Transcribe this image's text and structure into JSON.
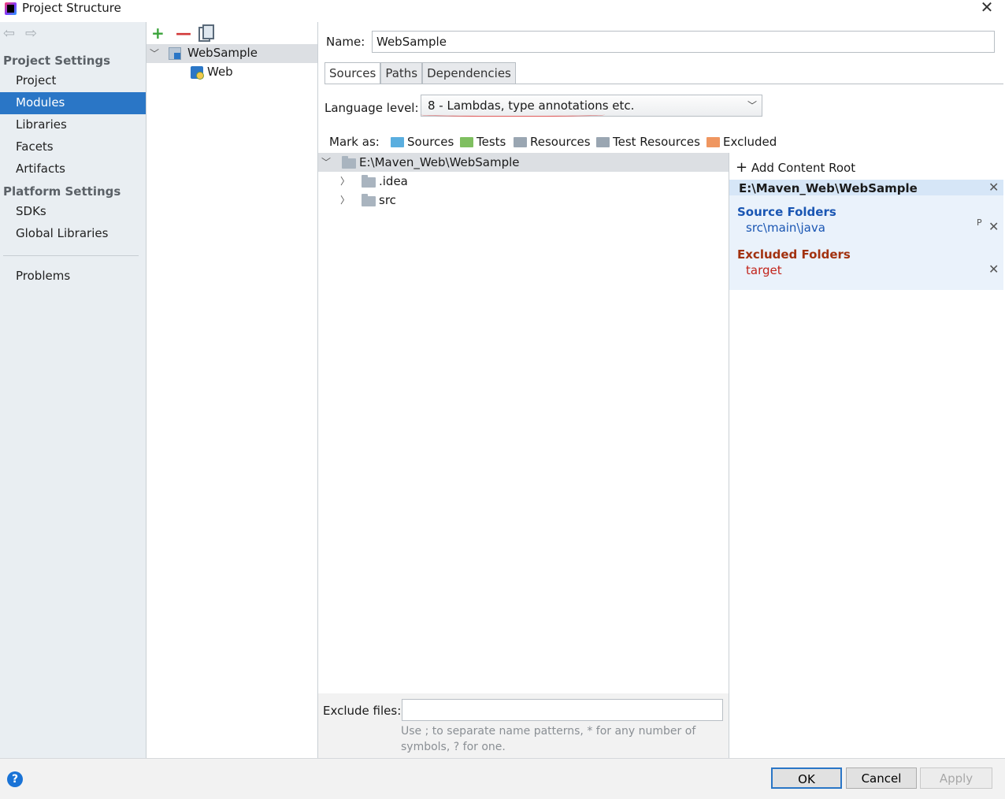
{
  "window": {
    "title": "Project Structure",
    "close_glyph": "✕"
  },
  "sidebar": {
    "nav_back": "⇦",
    "nav_forward": "⇨",
    "sections": [
      {
        "label": "Project Settings"
      },
      {
        "label": "Platform Settings"
      }
    ],
    "items": [
      {
        "label": "Project"
      },
      {
        "label": "Modules",
        "selected": true
      },
      {
        "label": "Libraries"
      },
      {
        "label": "Facets"
      },
      {
        "label": "Artifacts"
      },
      {
        "label": "SDKs"
      },
      {
        "label": "Global Libraries"
      },
      {
        "label": "Problems"
      }
    ]
  },
  "module_tree": {
    "toolbar": {
      "add": "+",
      "remove": "—",
      "copy": "copy-icon"
    },
    "root": {
      "label": "WebSample"
    },
    "children": [
      {
        "label": "Web"
      }
    ]
  },
  "content": {
    "name_label": "Name:",
    "name_value": "WebSample",
    "tabs": [
      {
        "label": "Sources",
        "active": true
      },
      {
        "label": "Paths"
      },
      {
        "label": "Dependencies"
      }
    ],
    "language_level_label": "Language level:",
    "language_level_value": "8 - Lambdas, type annotations etc.",
    "mark_as_label": "Mark as:",
    "mark_as": [
      {
        "label": "Sources",
        "color": "#5aaedf"
      },
      {
        "label": "Tests",
        "color": "#7fbf60"
      },
      {
        "label": "Resources",
        "color": "#9aa6b2"
      },
      {
        "label": "Test Resources",
        "color": "#9aa6b2"
      },
      {
        "label": "Excluded",
        "color": "#ef9660"
      }
    ],
    "file_tree": {
      "root": "E:\\Maven_Web\\WebSample",
      "children": [
        {
          "label": ".idea"
        },
        {
          "label": "src"
        }
      ]
    },
    "content_root": {
      "add_label": "Add Content Root",
      "path": "E:\\Maven_Web\\WebSample",
      "source_folders_label": "Source Folders",
      "source_folder": "src\\main\\java",
      "source_props": "P",
      "excluded_folders_label": "Excluded Folders",
      "excluded_folder": "target"
    },
    "exclude_files_label": "Exclude files:",
    "exclude_files_value": "",
    "exclude_files_hint": "Use ; to separate name patterns, * for any number of symbols, ? for one."
  },
  "buttons": {
    "help": "?",
    "ok": "OK",
    "cancel": "Cancel",
    "apply": "Apply"
  },
  "colors": {
    "selection": "#2a76c6",
    "source_folder": "#1a56b3",
    "excluded_folder": "#a2320f"
  }
}
